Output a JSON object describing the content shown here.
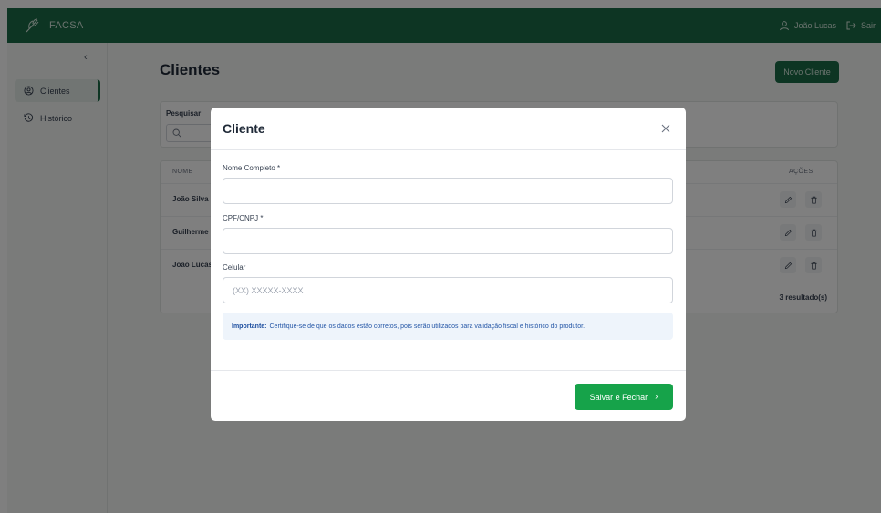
{
  "app": {
    "brand": "FACSA"
  },
  "user": {
    "name": "João Lucas",
    "logout_label": "Sair"
  },
  "sidebar": {
    "collapse_glyph": "‹",
    "items": [
      {
        "label": "Clientes",
        "icon": "user-circle-icon",
        "active": true
      },
      {
        "label": "Histórico",
        "icon": "history-icon",
        "active": false
      }
    ]
  },
  "page": {
    "title": "Clientes",
    "new_button_label": "Novo Cliente",
    "search_label": "Pesquisar"
  },
  "table": {
    "columns": {
      "name": "NOME",
      "actions": "AÇÕES"
    },
    "rows": [
      {
        "name": "João Silva"
      },
      {
        "name": "Guilherme ..."
      },
      {
        "name": "João Lucas"
      }
    ],
    "results_text": "3 resultado(s)"
  },
  "modal": {
    "title": "Cliente",
    "fields": {
      "full_name": {
        "label": "Nome Completo *",
        "value": "",
        "placeholder": ""
      },
      "document": {
        "label": "CPF/CNPJ *",
        "value": "",
        "placeholder": ""
      },
      "phone": {
        "label": "Celular",
        "value": "",
        "placeholder": "(XX) XXXXX-XXXX"
      }
    },
    "note_strong": "Importante:",
    "note_text": "Certifique-se de que os dados estão corretos, pois serão utilizados para validação fiscal e histórico do produtor.",
    "save_button_label": "Salvar e Fechar",
    "save_button_glyph": "›"
  },
  "colors": {
    "topbar": "#1a6b47",
    "primary_button": "#1a6b47",
    "save_button": "#16a34a",
    "note_background": "#eef4fb",
    "note_text": "#2456a6"
  }
}
